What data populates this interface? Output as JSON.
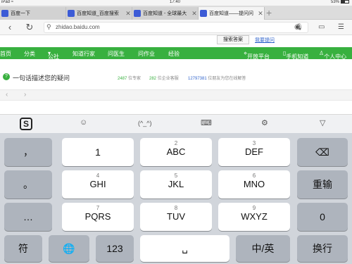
{
  "status": {
    "device": "iPad",
    "wifi": "≈",
    "time": "17:40",
    "battery": "53%"
  },
  "tabs": [
    {
      "title": "百度一下",
      "active": false
    },
    {
      "title": "百度知道_百度搜索",
      "active": false
    },
    {
      "title": "百度知道 - 全球最大",
      "active": false
    },
    {
      "title": "百度知道——提问问",
      "active": true
    }
  ],
  "address": {
    "url": "zhidao.baidu.com"
  },
  "page": {
    "search_button": "搜索答案",
    "feedback_link": "我要提问",
    "nav": [
      "首页",
      "分类",
      "公社",
      "知道行家",
      "问医生",
      "问作业",
      "经验"
    ],
    "nav_right": [
      "开放平台",
      "手机知道",
      "个人中心"
    ],
    "ask_prompt": "一句话描述您的疑问",
    "stats": [
      {
        "num": "2487",
        "label": "位专家",
        "color": "#38b03f"
      },
      {
        "num": "282",
        "label": "位企业客服",
        "color": "#38b03f"
      },
      {
        "num": "12797381",
        "label": "位朋友为您在线解答",
        "color": "#3366cc"
      }
    ]
  },
  "keyboard": {
    "toolbar": [
      "sogou-logo",
      "☺",
      "(^_^)",
      "⌨",
      "⚙",
      "▽"
    ],
    "logo_letter": "S",
    "row1": [
      {
        "num": "",
        "label": "，"
      },
      {
        "num": "",
        "label": "1"
      },
      {
        "num": "2",
        "label": "ABC"
      },
      {
        "num": "3",
        "label": "DEF"
      },
      {
        "num": "",
        "label": "⌫"
      }
    ],
    "row2": [
      {
        "num": "",
        "label": "。"
      },
      {
        "num": "4",
        "label": "GHI"
      },
      {
        "num": "5",
        "label": "JKL"
      },
      {
        "num": "6",
        "label": "MNO"
      },
      {
        "num": "",
        "label": "重输"
      }
    ],
    "row3": [
      {
        "num": "",
        "label": "…"
      },
      {
        "num": "7",
        "label": "PQRS"
      },
      {
        "num": "8",
        "label": "TUV"
      },
      {
        "num": "9",
        "label": "WXYZ"
      },
      {
        "num": "",
        "label": "0"
      }
    ],
    "row4": [
      {
        "label": "符"
      },
      {
        "label": "🌐"
      },
      {
        "label": "123"
      },
      {
        "label": "␣"
      },
      {
        "label": "中/英"
      },
      {
        "label": "换行"
      }
    ]
  }
}
